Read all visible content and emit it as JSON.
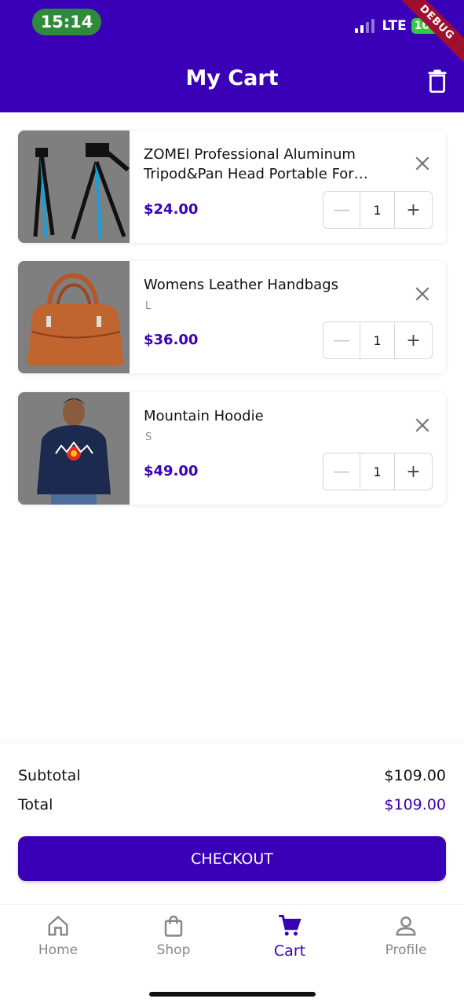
{
  "status_bar": {
    "time": "15:14",
    "network": "LTE",
    "battery": "100",
    "debug_label": "DEBUG"
  },
  "header": {
    "title": "My Cart",
    "icon": "trash-icon"
  },
  "colors": {
    "primary": "#3a00b8",
    "price": "#3a00b8",
    "muted": "#888888"
  },
  "cart": {
    "items": [
      {
        "name": "ZOMEI Professional Aluminum Tripod&Pan Head Portable For Camera",
        "variant": "",
        "price": "$24.00",
        "quantity": "1",
        "image": "tripod-image"
      },
      {
        "name": "Womens Leather Handbags",
        "variant": "L",
        "price": "$36.00",
        "quantity": "1",
        "image": "handbag-image"
      },
      {
        "name": "Mountain Hoodie",
        "variant": "S",
        "price": "$49.00",
        "quantity": "1",
        "image": "hoodie-image"
      }
    ]
  },
  "summary": {
    "subtotal_label": "Subtotal",
    "subtotal_value": "$109.00",
    "total_label": "Total",
    "total_value": "$109.00",
    "checkout_label": "CHECKOUT"
  },
  "tabbar": {
    "items": [
      {
        "label": "Home",
        "icon": "home-icon"
      },
      {
        "label": "Shop",
        "icon": "shopping-bag-icon"
      },
      {
        "label": "Cart",
        "icon": "cart-icon",
        "active": true
      },
      {
        "label": "Profile",
        "icon": "person-icon"
      }
    ]
  }
}
